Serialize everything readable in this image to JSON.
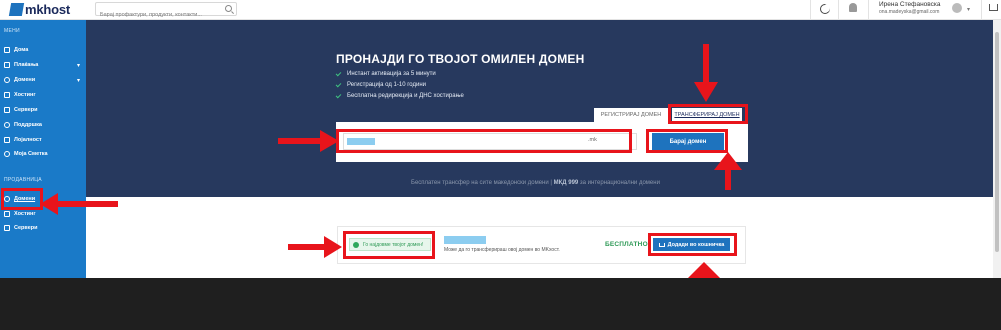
{
  "topbar": {
    "logo_text": "mkhost",
    "search_placeholder": "Барај профактури, продукти, контакти...",
    "user_name": "Ирена Стефановска",
    "user_email": "ona.madeyska@gmail.com"
  },
  "sidebar": {
    "menu_header": "МЕНИ",
    "items": [
      {
        "label": "Дома",
        "icon": "home-icon"
      },
      {
        "label": "Плаќања",
        "icon": "card-icon",
        "chevron": "▾"
      },
      {
        "label": "Домени",
        "icon": "globe-icon",
        "chevron": "▾"
      },
      {
        "label": "Хостинг",
        "icon": "server-icon"
      },
      {
        "label": "Сервери",
        "icon": "server-icon"
      },
      {
        "label": "Поддршка",
        "icon": "support-icon"
      },
      {
        "label": "Лојалност",
        "icon": "users-icon"
      },
      {
        "label": "Моја Сметка",
        "icon": "gear-icon"
      }
    ],
    "shop_header": "ПРОДАВНИЦА",
    "shop_items": [
      {
        "label": "Домени",
        "icon": "globe-icon"
      },
      {
        "label": "Хостинг",
        "icon": "server-icon"
      },
      {
        "label": "Сервери",
        "icon": "server-icon"
      }
    ]
  },
  "hero": {
    "title": "ПРОНАЈДИ ГО ТВОЈОТ ОМИЛЕН ДОМЕН",
    "features": [
      "Инстант активација за 5 минути",
      "Регистрација од 1-10 години",
      "Бесплатна редирекција и ДНС хостирање"
    ],
    "tab_register": "РЕГИСТРИРАЈ ДОМЕН",
    "tab_transfer": "ТРАНСФЕРИРАЈ ДОМЕН",
    "domain_ext": ".mk",
    "search_button": "Барај домен",
    "note_prefix": "Бесплатен трансфер на сите македонски домени |",
    "note_price": "МКД 999",
    "note_suffix": "за интернационални домени"
  },
  "result": {
    "badge": "Го најдовме твојот домен!",
    "description": "Може да го трансферираш овој домен во MKхост.",
    "price": "БЕСПЛАТНО",
    "add_button": "Додади во кошничка"
  },
  "colors": {
    "annotation": "#e8141b",
    "sidebar": "#1a7ac8",
    "hero": "#27395e",
    "primary_button": "#1e73be"
  }
}
